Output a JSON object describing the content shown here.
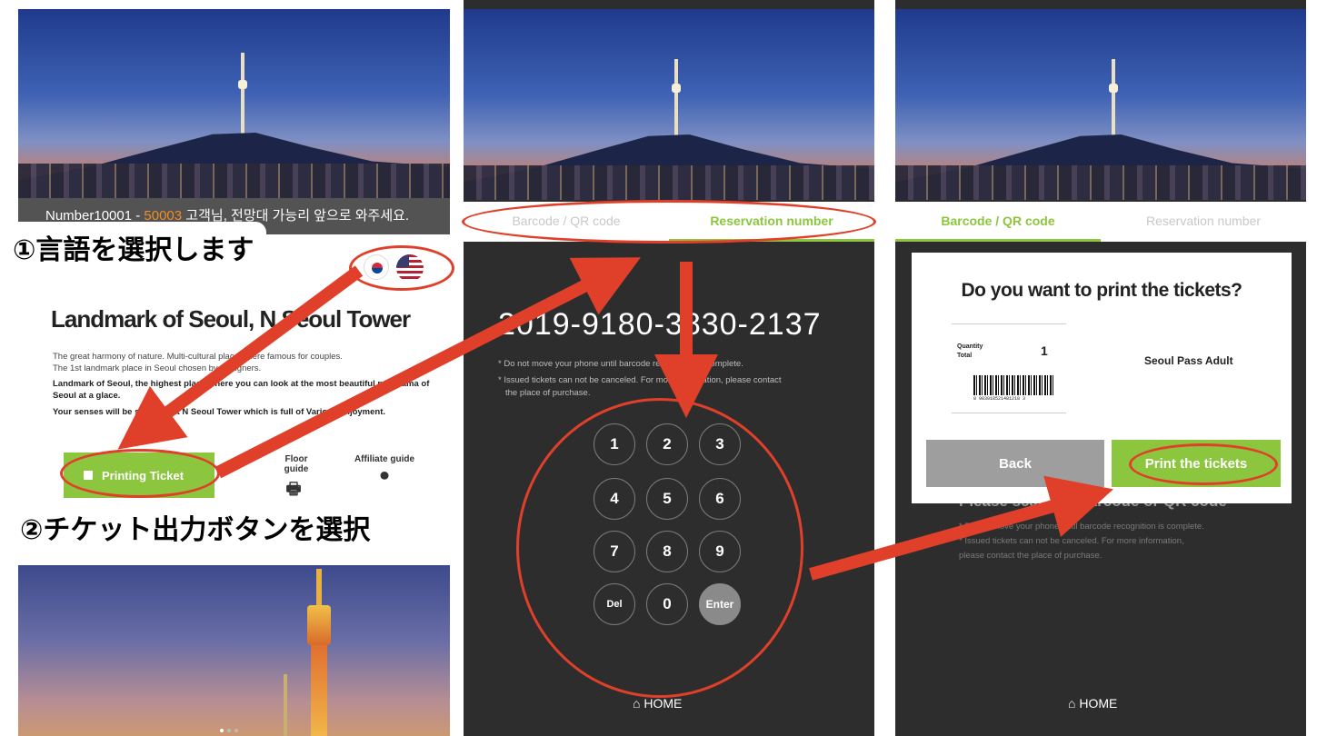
{
  "panel1": {
    "number_banner_prefix": "Number10001 - ",
    "number_banner_range": "50003",
    "number_banner_suffix": " 고객님, 전망대 가능리 앞으로 와주세요.",
    "title": "Landmark of Seoul, N Seoul Tower",
    "desc_line1": "The great harmony of nature. Multi-cultural place where famous for couples.",
    "desc_line2": "The 1st landmark place in Seoul chosen by foreigners.",
    "desc_line3": "Landmark of Seoul, the highest place where you can look at the most beautiful panorama of",
    "desc_line4": "Seoul at a glace.",
    "desc_line5": "Your senses will be satisfied at N Seoul Tower which is full of Various enjoyment.",
    "printing_ticket_label": "Printing Ticket",
    "floor_guide_label": "Floor guide",
    "affiliate_guide_label": "Affiliate guide"
  },
  "panel2": {
    "tab_barcode": "Barcode / QR code",
    "tab_reservation": "Reservation number",
    "reservation_number": "2019-9180-3830-2137",
    "note1": "* Do not move your phone until barcode recognition is complete.",
    "note2": "* Issued tickets can not be canceled. For more information, please contact",
    "note3": "the place of purchase.",
    "keys": [
      "1",
      "2",
      "3",
      "4",
      "5",
      "6",
      "7",
      "8",
      "9",
      "Del",
      "0",
      "Enter"
    ],
    "home_label": "HOME"
  },
  "panel3": {
    "tab_barcode": "Barcode / QR code",
    "tab_reservation": "Reservation number",
    "dialog_title": "Do you want to print the tickets?",
    "quantity_label": "Quantity",
    "total_label": "Total",
    "quantity_value": "1",
    "product_name": "Seoul Pass Adult",
    "barcode_digits": "8 983018521481218 3",
    "back_label": "Back",
    "print_label": "Print the tickets",
    "behind_heading": "Please scan the barcode or QR code",
    "behind_note1": "* Do not move your phone until barcode recognition is complete.",
    "behind_note2": "* Issued tickets can not be canceled. For more information,",
    "behind_note3": "please contact the place of purchase.",
    "home_label": "HOME"
  },
  "callouts": {
    "step1": "①言語を選択します",
    "step2": "②チケット出力ボタンを選択"
  },
  "colors": {
    "accent_green": "#8cc63e",
    "annotation_red": "#e0402a",
    "dark_bg": "#2d2d2d"
  }
}
